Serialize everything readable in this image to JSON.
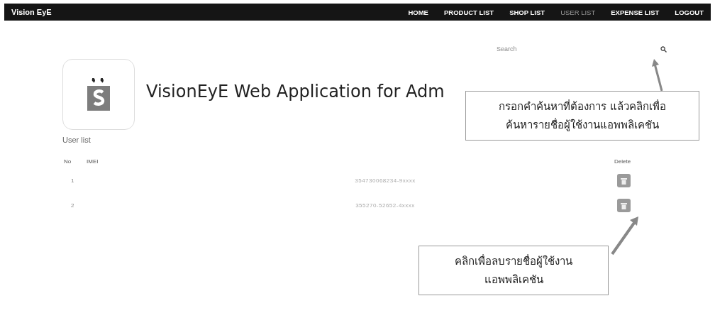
{
  "navbar": {
    "brand": "Vision EyE",
    "items": [
      {
        "label": "HOME",
        "selected": false
      },
      {
        "label": "PRODUCT LIST",
        "selected": false
      },
      {
        "label": "SHOP LIST",
        "selected": false
      },
      {
        "label": "USER LIST",
        "selected": true
      },
      {
        "label": "EXPENSE LIST",
        "selected": false
      },
      {
        "label": "LOGOUT",
        "selected": false
      }
    ]
  },
  "search": {
    "placeholder": "Search"
  },
  "title": "VisionEyE Web Application for Adm",
  "section_title": "User list",
  "table": {
    "columns": [
      "No",
      "IMEI",
      "Delete"
    ],
    "rows": [
      {
        "no": "1",
        "imei": "354730068234-9xxxx"
      },
      {
        "no": "2",
        "imei": "355270-52652-4xxxx"
      }
    ]
  },
  "callouts": [
    {
      "lines": [
        "กรอกคำค้นหาที่ต้องการ แล้วคลิกเพื่อ",
        "ค้นหารายชื่อผู้ใช้งานแอพพลิเคชัน"
      ]
    },
    {
      "lines": [
        "คลิกเพื่อลบรายชื่อผู้ใช้งาน",
        "แอพพลิเคชัน"
      ]
    }
  ]
}
